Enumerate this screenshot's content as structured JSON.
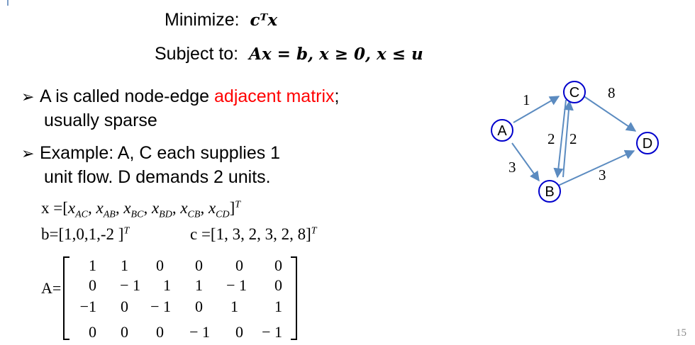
{
  "objective": {
    "minimize_label": "Minimize:",
    "minimize_expr": "cᵀx",
    "subject_label": "Subject to:",
    "constraints": "Ax = b,  x ≥ 0,   x ≤ u"
  },
  "bullets": [
    {
      "arrow": "➢",
      "line1_pre": "A is called node-edge ",
      "line1_highlight": "adjacent matrix",
      "line1_post": ";",
      "line2": "usually sparse"
    },
    {
      "arrow": "➢",
      "line1": "Example: A, C each supplies 1",
      "line2": "unit flow. D demands 2 units."
    }
  ],
  "vectors": {
    "x": "x =[x_AC, x_AB, x_BC, x_BD, x_CB, x_CD]^T",
    "x_prefix": "x =[",
    "x_vars": [
      "x",
      "x",
      "x",
      "x",
      "x",
      "x"
    ],
    "x_subs": [
      "AC",
      "AB",
      "BC",
      "BD",
      "CB",
      "CD"
    ],
    "x_suffix": "]",
    "transpose": "T",
    "b_text": "b=[1,0,1,-2 ]",
    "c_text": "c =[1, 3, 2, 3, 2, 8]"
  },
  "matrix": {
    "label": "A=",
    "rows": [
      [
        "1",
        "1",
        "0",
        "0",
        "0",
        "0"
      ],
      [
        "0",
        "− 1",
        "1",
        "1",
        "− 1",
        "0"
      ],
      [
        "−1",
        "0",
        "− 1",
        "0",
        "1",
        "1"
      ],
      [
        "0",
        "0",
        "0",
        "− 1",
        "0",
        "− 1"
      ]
    ]
  },
  "graph": {
    "nodes": [
      "A",
      "B",
      "C",
      "D"
    ],
    "edge_labels": {
      "AC": "1",
      "AB": "3",
      "BC": "2",
      "CB": "2",
      "BD": "3",
      "CD": "8"
    },
    "node_stroke_color": "#0000cc",
    "edge_color": "#5b8bc0"
  },
  "page_number": "15",
  "colors": {
    "highlight": "#ff0000"
  }
}
